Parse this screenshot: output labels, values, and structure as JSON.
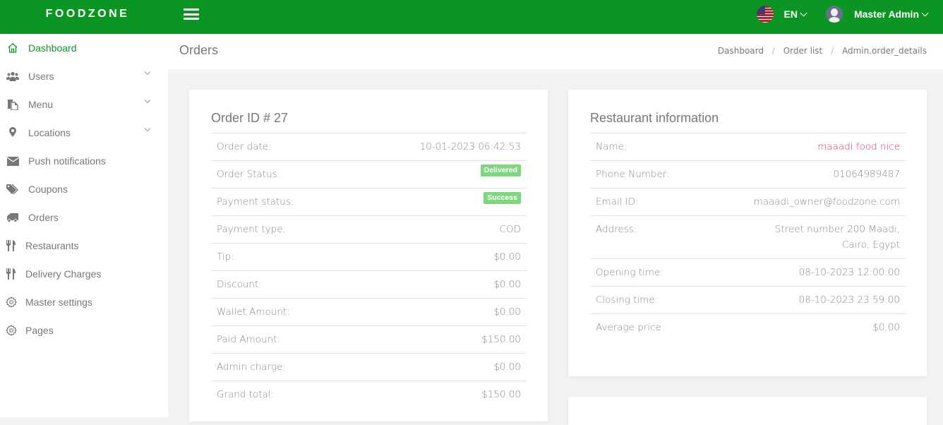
{
  "app": {
    "brand": "FOODZONE"
  },
  "topbar": {
    "language": "EN",
    "user_name": "Master Admin"
  },
  "sidebar": {
    "items": [
      {
        "label": "Dashboard",
        "icon": "home-icon",
        "active": true,
        "expandable": false
      },
      {
        "label": "Users",
        "icon": "users-icon",
        "active": false,
        "expandable": true
      },
      {
        "label": "Menu",
        "icon": "copy-icon",
        "active": false,
        "expandable": true
      },
      {
        "label": "Locations",
        "icon": "map-marker-icon",
        "active": false,
        "expandable": true
      },
      {
        "label": "Push notifications",
        "icon": "envelope-icon",
        "active": false,
        "expandable": false
      },
      {
        "label": "Coupons",
        "icon": "tags-icon",
        "active": false,
        "expandable": false
      },
      {
        "label": "Orders",
        "icon": "truck-icon",
        "active": false,
        "expandable": false
      },
      {
        "label": "Restaurants",
        "icon": "cutlery-icon",
        "active": false,
        "expandable": false
      },
      {
        "label": "Delivery Charges",
        "icon": "cutlery-icon",
        "active": false,
        "expandable": false
      },
      {
        "label": "Master settings",
        "icon": "gear-icon",
        "active": false,
        "expandable": false
      },
      {
        "label": "Pages",
        "icon": "gear-icon",
        "active": false,
        "expandable": false
      }
    ]
  },
  "header": {
    "title": "Orders",
    "breadcrumb": [
      "Dashboard",
      "Order list",
      "Admin.order_details"
    ]
  },
  "order": {
    "title": "Order ID # 27",
    "rows": [
      {
        "label": "Order date:",
        "value": "10-01-2023 06:42:53"
      },
      {
        "label": "Order Status:",
        "badge": "Delivered"
      },
      {
        "label": "Payment status:",
        "badge": "Success"
      },
      {
        "label": "Payment type:",
        "value": "COD"
      },
      {
        "label": "Tip:",
        "value": "$0.00"
      },
      {
        "label": "Discount:",
        "value": "$0.00"
      },
      {
        "label": "Wallet Amount:",
        "value": "$0.00"
      },
      {
        "label": "Paid Amount:",
        "value": "$150.00"
      },
      {
        "label": "Admin charge:",
        "value": "$0.00"
      },
      {
        "label": "Grand total:",
        "value": "$150.00"
      }
    ]
  },
  "restaurant": {
    "title": "Restaurant information",
    "rows": [
      {
        "label": "Name:",
        "value": "maaadi food nice"
      },
      {
        "label": "Phone Number:",
        "value": "01064989487"
      },
      {
        "label": "Email ID:",
        "value": "maaadi_owner@foodzone.com"
      },
      {
        "label": "Address:",
        "value_line1": "Street number 200 Maadi,",
        "value_line2": "Cairo, Egypt"
      },
      {
        "label": "Opening time:",
        "value": "08-10-2023 12:00:00"
      },
      {
        "label": "Closing time:",
        "value": "08-10-2023 23:59:00"
      },
      {
        "label": "Average price:",
        "value": "$0.00"
      }
    ]
  },
  "colors": {
    "brand_green": "#0b9623",
    "badge_green": "#7ed77e",
    "name_red": "#dc3545"
  }
}
